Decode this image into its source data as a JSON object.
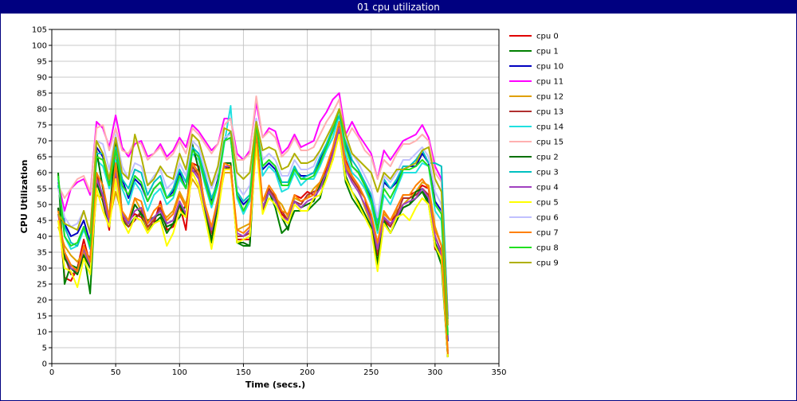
{
  "window": {
    "title": "01 cpu utilization"
  },
  "chart_data": {
    "type": "line",
    "xlabel": "Time (secs.)",
    "ylabel": "CPU Utilization",
    "xlim": [
      0,
      350
    ],
    "ylim": [
      0,
      105
    ],
    "x_ticks": [
      0,
      50,
      100,
      150,
      200,
      250,
      300,
      350
    ],
    "y_ticks": [
      0,
      5,
      10,
      15,
      20,
      25,
      30,
      35,
      40,
      45,
      50,
      55,
      60,
      65,
      70,
      75,
      80,
      85,
      90,
      95,
      100,
      105
    ],
    "grid": true,
    "legend_position": "right",
    "x": [
      5,
      10,
      15,
      20,
      25,
      30,
      35,
      40,
      45,
      50,
      55,
      60,
      65,
      70,
      75,
      80,
      85,
      90,
      95,
      100,
      105,
      110,
      115,
      120,
      125,
      130,
      135,
      140,
      145,
      150,
      155,
      160,
      165,
      170,
      175,
      180,
      185,
      190,
      195,
      200,
      205,
      210,
      215,
      220,
      225,
      230,
      235,
      240,
      245,
      250,
      255,
      260,
      265,
      270,
      275,
      280,
      285,
      290,
      295,
      300,
      305,
      310
    ],
    "series": [
      {
        "name": "cpu 0",
        "color": "#e00000",
        "values": [
          49,
          27,
          26,
          30,
          39,
          31,
          59,
          51,
          42,
          69,
          46,
          45,
          47,
          46,
          43,
          44,
          51,
          42,
          43,
          50,
          42,
          63,
          62,
          49,
          39,
          51,
          63,
          63,
          39,
          39,
          39,
          74,
          49,
          54,
          53,
          47,
          45,
          53,
          52,
          54,
          53,
          57,
          61,
          67,
          76,
          64,
          59,
          56,
          52,
          44,
          34,
          45,
          43,
          49,
          53,
          53,
          54,
          56,
          55,
          36,
          34,
          2
        ]
      },
      {
        "name": "cpu 1",
        "color": "#008000",
        "values": [
          60,
          25,
          31,
          30,
          35,
          22,
          57,
          51,
          43,
          60,
          45,
          43,
          46,
          47,
          42,
          44,
          46,
          41,
          44,
          46,
          50,
          60,
          61,
          47,
          38,
          48,
          61,
          62,
          38,
          37,
          37,
          72,
          48,
          54,
          49,
          41,
          43,
          48,
          48,
          48,
          50,
          52,
          60,
          64,
          73,
          57,
          52,
          49,
          46,
          43,
          31,
          45,
          41,
          46,
          49,
          50,
          52,
          54,
          50,
          37,
          31,
          2
        ]
      },
      {
        "name": "cpu 10",
        "color": "#0000c0",
        "values": [
          57,
          44,
          40,
          41,
          45,
          38,
          68,
          65,
          56,
          68,
          58,
          52,
          58,
          56,
          51,
          55,
          57,
          52,
          54,
          60,
          55,
          67,
          65,
          59,
          51,
          58,
          70,
          71,
          53,
          50,
          52,
          74,
          61,
          63,
          61,
          56,
          56,
          61,
          59,
          59,
          60,
          64,
          68,
          73,
          79,
          70,
          62,
          60,
          56,
          52,
          43,
          57,
          55,
          57,
          61,
          62,
          62,
          66,
          63,
          51,
          48,
          7
        ]
      },
      {
        "name": "cpu 11",
        "color": "#ff00ff",
        "values": [
          57,
          48,
          55,
          57,
          58,
          53,
          76,
          74,
          68,
          78,
          68,
          65,
          69,
          70,
          65,
          66,
          69,
          65,
          67,
          71,
          68,
          75,
          73,
          70,
          67,
          69,
          77,
          77,
          66,
          64,
          67,
          82,
          71,
          74,
          73,
          66,
          68,
          72,
          68,
          69,
          70,
          76,
          79,
          83,
          85,
          72,
          76,
          72,
          69,
          66,
          58,
          67,
          64,
          67,
          70,
          71,
          72,
          75,
          71,
          62,
          58,
          15
        ]
      },
      {
        "name": "cpu 12",
        "color": "#e0a000",
        "values": [
          43,
          37,
          34,
          32,
          35,
          31,
          53,
          52,
          45,
          54,
          47,
          45,
          52,
          48,
          42,
          46,
          48,
          46,
          48,
          54,
          50,
          58,
          55,
          46,
          42,
          49,
          60,
          60,
          42,
          43,
          44,
          68,
          51,
          54,
          52,
          50,
          46,
          52,
          51,
          52,
          55,
          57,
          60,
          65,
          72,
          62,
          58,
          55,
          49,
          44,
          37,
          47,
          45,
          48,
          50,
          52,
          54,
          57,
          56,
          43,
          37,
          4
        ]
      },
      {
        "name": "cpu 13",
        "color": "#b03030",
        "values": [
          45,
          34,
          28,
          29,
          36,
          33,
          60,
          52,
          44,
          60,
          46,
          43,
          45,
          48,
          43,
          45,
          49,
          44,
          45,
          51,
          47,
          62,
          59,
          48,
          41,
          50,
          62,
          61,
          40,
          40,
          41,
          72,
          48,
          55,
          52,
          48,
          45,
          51,
          50,
          53,
          54,
          55,
          60,
          66,
          74,
          61,
          58,
          55,
          52,
          46,
          35,
          46,
          43,
          47,
          52,
          52,
          53,
          55,
          53,
          40,
          35,
          3
        ]
      },
      {
        "name": "cpu 14",
        "color": "#20e0e0",
        "values": [
          58,
          40,
          36,
          37,
          42,
          37,
          64,
          62,
          55,
          64,
          55,
          50,
          57,
          54,
          48,
          53,
          55,
          50,
          52,
          58,
          55,
          66,
          64,
          56,
          49,
          56,
          69,
          81,
          52,
          47,
          51,
          76,
          59,
          62,
          60,
          54,
          55,
          60,
          56,
          58,
          58,
          62,
          67,
          71,
          78,
          66,
          60,
          58,
          55,
          50,
          41,
          53,
          50,
          55,
          60,
          60,
          60,
          63,
          62,
          48,
          45,
          10
        ]
      },
      {
        "name": "cpu 15",
        "color": "#ffb0b0",
        "values": [
          56,
          52,
          55,
          58,
          59,
          54,
          74,
          75,
          67,
          74,
          67,
          66,
          70,
          69,
          64,
          66,
          68,
          64,
          66,
          70,
          66,
          74,
          72,
          69,
          66,
          69,
          75,
          77,
          64,
          64,
          66,
          84,
          71,
          73,
          71,
          65,
          67,
          71,
          67,
          67,
          68,
          72,
          76,
          79,
          83,
          70,
          74,
          71,
          67,
          65,
          58,
          64,
          62,
          66,
          69,
          69,
          70,
          72,
          70,
          60,
          57,
          13
        ]
      },
      {
        "name": "cpu 2",
        "color": "#007000",
        "values": [
          49,
          33,
          30,
          28,
          34,
          30,
          67,
          55,
          46,
          70,
          47,
          44,
          50,
          47,
          45,
          46,
          47,
          43,
          44,
          50,
          46,
          69,
          61,
          47,
          39,
          49,
          63,
          63,
          38,
          38,
          37,
          74,
          49,
          54,
          51,
          46,
          42,
          51,
          49,
          50,
          51,
          56,
          60,
          66,
          75,
          59,
          54,
          51,
          47,
          43,
          32,
          44,
          41,
          45,
          49,
          50,
          54,
          55,
          51,
          38,
          33,
          2
        ]
      },
      {
        "name": "cpu 3",
        "color": "#00c0c0",
        "values": [
          56,
          43,
          38,
          37,
          43,
          36,
          66,
          66,
          58,
          68,
          58,
          55,
          61,
          60,
          53,
          57,
          59,
          52,
          55,
          61,
          57,
          68,
          66,
          59,
          52,
          57,
          70,
          73,
          54,
          51,
          53,
          77,
          62,
          64,
          62,
          57,
          57,
          62,
          58,
          59,
          60,
          65,
          69,
          74,
          78,
          70,
          64,
          61,
          57,
          53,
          44,
          58,
          55,
          58,
          62,
          62,
          64,
          67,
          63,
          63,
          62,
          14
        ]
      },
      {
        "name": "cpu 4",
        "color": "#a040c0",
        "values": [
          47,
          35,
          30,
          29,
          36,
          31,
          58,
          53,
          44,
          61,
          47,
          44,
          48,
          49,
          44,
          46,
          48,
          44,
          45,
          51,
          47,
          61,
          58,
          49,
          42,
          51,
          62,
          62,
          41,
          40,
          42,
          71,
          49,
          54,
          51,
          46,
          45,
          51,
          49,
          51,
          52,
          55,
          60,
          66,
          74,
          61,
          57,
          54,
          50,
          45,
          36,
          46,
          44,
          46,
          50,
          51,
          52,
          55,
          52,
          40,
          34,
          3
        ]
      },
      {
        "name": "cpu 5",
        "color": "#ffff00",
        "values": [
          45,
          30,
          29,
          24,
          33,
          28,
          55,
          48,
          43,
          58,
          45,
          41,
          46,
          45,
          41,
          44,
          45,
          37,
          41,
          48,
          46,
          60,
          56,
          46,
          36,
          47,
          61,
          61,
          38,
          39,
          40,
          69,
          47,
          52,
          50,
          46,
          44,
          50,
          48,
          48,
          52,
          53,
          58,
          64,
          72,
          58,
          54,
          50,
          46,
          42,
          29,
          44,
          41,
          46,
          47,
          45,
          49,
          52,
          50,
          37,
          33,
          2
        ]
      },
      {
        "name": "cpu 6",
        "color": "#c0c0ff",
        "values": [
          55,
          46,
          43,
          44,
          48,
          41,
          70,
          69,
          61,
          72,
          62,
          58,
          63,
          62,
          56,
          59,
          61,
          55,
          57,
          63,
          59,
          70,
          68,
          61,
          55,
          60,
          71,
          72,
          56,
          53,
          56,
          77,
          64,
          66,
          64,
          59,
          59,
          64,
          61,
          61,
          62,
          67,
          71,
          75,
          79,
          71,
          66,
          63,
          59,
          55,
          46,
          59,
          57,
          60,
          64,
          64,
          66,
          68,
          65,
          54,
          50,
          10
        ]
      },
      {
        "name": "cpu 7",
        "color": "#ff8000",
        "values": [
          48,
          35,
          31,
          29,
          37,
          32,
          60,
          56,
          46,
          63,
          48,
          45,
          52,
          51,
          44,
          48,
          50,
          45,
          47,
          53,
          49,
          63,
          60,
          50,
          43,
          52,
          63,
          62,
          42,
          41,
          43,
          73,
          51,
          56,
          53,
          48,
          47,
          53,
          51,
          52,
          53,
          57,
          62,
          68,
          76,
          63,
          59,
          56,
          52,
          47,
          38,
          48,
          45,
          49,
          53,
          53,
          56,
          58,
          55,
          42,
          37,
          3
        ]
      },
      {
        "name": "cpu 8",
        "color": "#20e020",
        "values": [
          59,
          40,
          37,
          38,
          43,
          37,
          65,
          64,
          56,
          67,
          56,
          53,
          59,
          57,
          51,
          55,
          57,
          52,
          53,
          59,
          55,
          67,
          65,
          57,
          50,
          57,
          70,
          71,
          53,
          48,
          52,
          75,
          62,
          64,
          62,
          56,
          56,
          61,
          58,
          58,
          59,
          63,
          68,
          73,
          80,
          68,
          62,
          60,
          56,
          51,
          42,
          55,
          52,
          56,
          61,
          61,
          62,
          64,
          62,
          50,
          47,
          9
        ]
      },
      {
        "name": "cpu 9",
        "color": "#b0b000",
        "values": [
          47,
          44,
          43,
          42,
          48,
          41,
          70,
          66,
          58,
          71,
          60,
          58,
          72,
          65,
          56,
          58,
          62,
          59,
          58,
          66,
          61,
          72,
          70,
          63,
          56,
          62,
          74,
          73,
          60,
          58,
          60,
          76,
          67,
          68,
          67,
          61,
          62,
          66,
          63,
          63,
          64,
          67,
          71,
          75,
          80,
          72,
          66,
          64,
          62,
          60,
          54,
          60,
          58,
          61,
          61,
          62,
          63,
          67,
          68,
          58,
          54,
          12
        ]
      }
    ]
  }
}
